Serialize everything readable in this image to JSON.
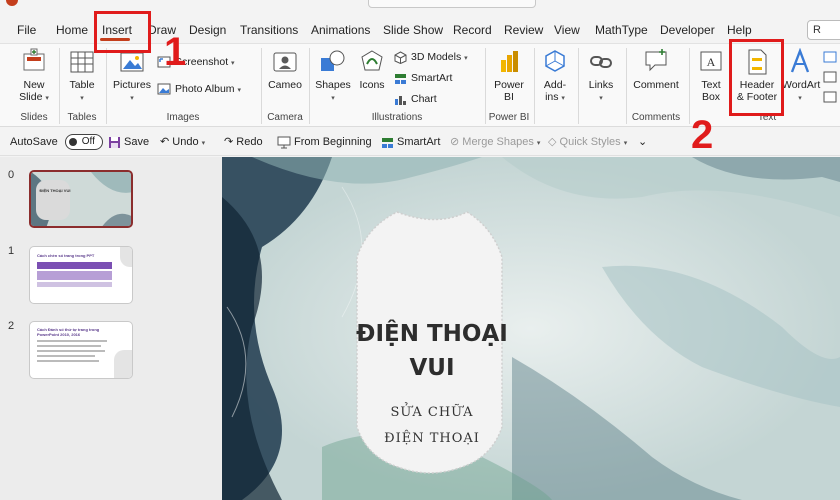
{
  "tabs": [
    {
      "label": "File"
    },
    {
      "label": "Home"
    },
    {
      "label": "Insert"
    },
    {
      "label": "Draw"
    },
    {
      "label": "Design"
    },
    {
      "label": "Transitions"
    },
    {
      "label": "Animations"
    },
    {
      "label": "Slide Show"
    },
    {
      "label": "Record"
    },
    {
      "label": "Review"
    },
    {
      "label": "View"
    },
    {
      "label": "MathType"
    },
    {
      "label": "Developer"
    },
    {
      "label": "Help"
    }
  ],
  "share_label": "R",
  "ribbon": {
    "groups": {
      "slides": "Slides",
      "tables": "Tables",
      "images": "Images",
      "camera": "Camera",
      "illustrations": "Illustrations",
      "powerbi": "Power BI",
      "comments": "Comments",
      "text": "Text"
    },
    "buttons": {
      "new_slide_1": "New",
      "new_slide_2": "Slide",
      "table": "Table",
      "pictures": "Pictures",
      "screenshot": "Screenshot",
      "photo_album": "Photo Album",
      "cameo": "Cameo",
      "shapes": "Shapes",
      "icons": "Icons",
      "models_3d": "3D Models",
      "smartart": "SmartArt",
      "chart": "Chart",
      "power_bi_1": "Power",
      "power_bi_2": "BI",
      "addins_1": "Add-",
      "addins_2": "ins",
      "links": "Links",
      "comment": "Comment",
      "text_box_1": "Text",
      "text_box_2": "Box",
      "header_footer_1": "Header",
      "header_footer_2": "& Footer",
      "wordart": "WordArt"
    }
  },
  "qat": {
    "autosave": "AutoSave",
    "autosave_state": "Off",
    "save": "Save",
    "undo": "Undo",
    "redo": "Redo",
    "from_beginning": "From Beginning",
    "smartart": "SmartArt",
    "merge_shapes": "Merge Shapes",
    "quick_styles": "Quick Styles"
  },
  "thumbnails": [
    {
      "number": "0",
      "title": "ĐIỆN THOẠI VUI"
    },
    {
      "number": "1",
      "title": "Cách chèn số trang trong PPT"
    },
    {
      "number": "2",
      "title": "Cách Đánh số thứ tự trang trong PowerPoint 2010, 2016"
    }
  ],
  "slide": {
    "title_line1": "ĐIỆN THOẠI",
    "title_line2": "VUI",
    "subtitle_line1": "SỬA CHỮA",
    "subtitle_line2": "ĐIỆN THOẠI"
  },
  "annotations": {
    "step1": "1",
    "step2": "2"
  },
  "colors": {
    "accent": "#c43e1c",
    "annotation": "#e01b1b",
    "slide_title": "#2d2d2d"
  }
}
